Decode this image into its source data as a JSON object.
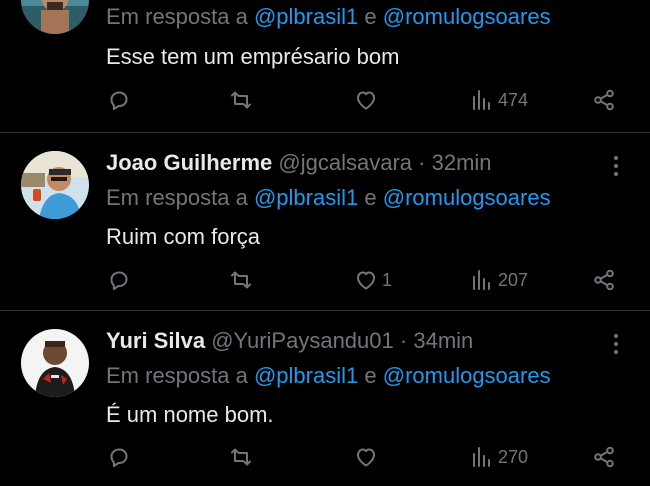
{
  "tweets": [
    {
      "name": "",
      "handle": "",
      "time": "",
      "reply_prefix": "Em resposta a",
      "mention1": "@plbrasil1",
      "reply_and": "e",
      "mention2": "@romulogsoares",
      "text": "Esse tem um emprésario bom",
      "likes": "",
      "views": "474"
    },
    {
      "name": "Joao Guilherme",
      "handle": "@jgcalsavara",
      "dot": "·",
      "time": "32min",
      "reply_prefix": "Em resposta a",
      "mention1": "@plbrasil1",
      "reply_and": "e",
      "mention2": "@romulogsoares",
      "text": "Ruim com força",
      "likes": "1",
      "views": "207"
    },
    {
      "name": "Yuri Silva",
      "handle": "@YuriPaysandu01",
      "dot": "·",
      "time": "34min",
      "reply_prefix": "Em resposta a",
      "mention1": "@plbrasil1",
      "reply_and": "e",
      "mention2": "@romulogsoares",
      "text": "É um nome bom.",
      "likes": "",
      "views": "270"
    }
  ],
  "icons": {
    "reply": "reply-icon",
    "retweet": "retweet-icon",
    "like": "heart-icon",
    "views": "views-icon",
    "share": "share-icon",
    "more": "more-icon"
  },
  "colors": {
    "background": "#000000",
    "text": "#e7e9ea",
    "muted": "#71767b",
    "link": "#1d9bf0",
    "divider": "#2f3336"
  }
}
